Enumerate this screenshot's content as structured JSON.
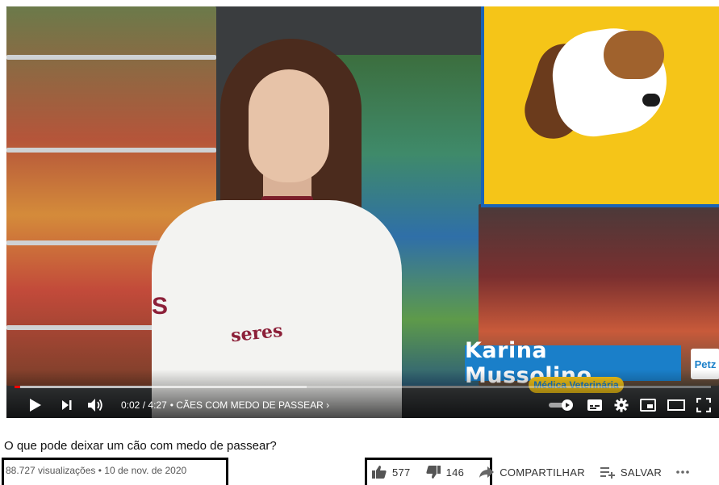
{
  "player": {
    "time_current": "0:02",
    "time_total": "4:27",
    "time_separator": "/",
    "chapter": "CÃES COM MEDO DE PASSEAR",
    "progress": 0.008,
    "buffered": 0.42
  },
  "overlay": {
    "name": "Karina Mussolino",
    "role": "Médica Veterinária",
    "brand": "Petz",
    "coat_brand": "seres"
  },
  "video": {
    "title": "O que pode deixar um cão com medo de passear?",
    "views": "88.727 visualizações",
    "date": "10 de nov. de 2020",
    "likes": "577",
    "dislikes": "146",
    "share_label": "COMPARTILHAR",
    "save_label": "SALVAR"
  },
  "colors": {
    "progress": "#ff0000",
    "lower_third": "#1a7fc9",
    "poster": "#f5c518"
  }
}
